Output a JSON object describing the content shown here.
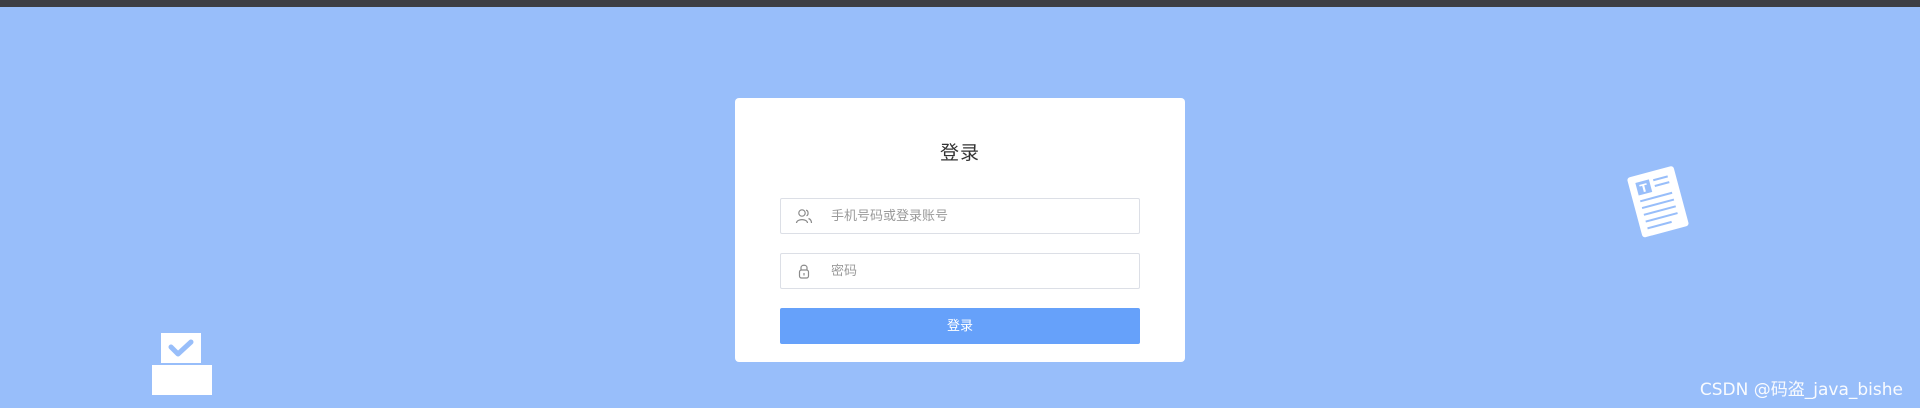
{
  "page": {
    "background_color": "#98befa",
    "topbar_color": "#3d3f44"
  },
  "login": {
    "title": "登录",
    "username": {
      "icon": "user-icon",
      "placeholder": "手机号码或登录账号",
      "value": ""
    },
    "password": {
      "icon": "lock-icon",
      "placeholder": "密码",
      "value": ""
    },
    "submit_label": "登录",
    "button_color": "#66a1fa"
  },
  "decorations": {
    "left_icon": "checkbox-tray-icon",
    "right_icon": "document-icon"
  },
  "watermark": "CSDN @码盗_java_bishe"
}
